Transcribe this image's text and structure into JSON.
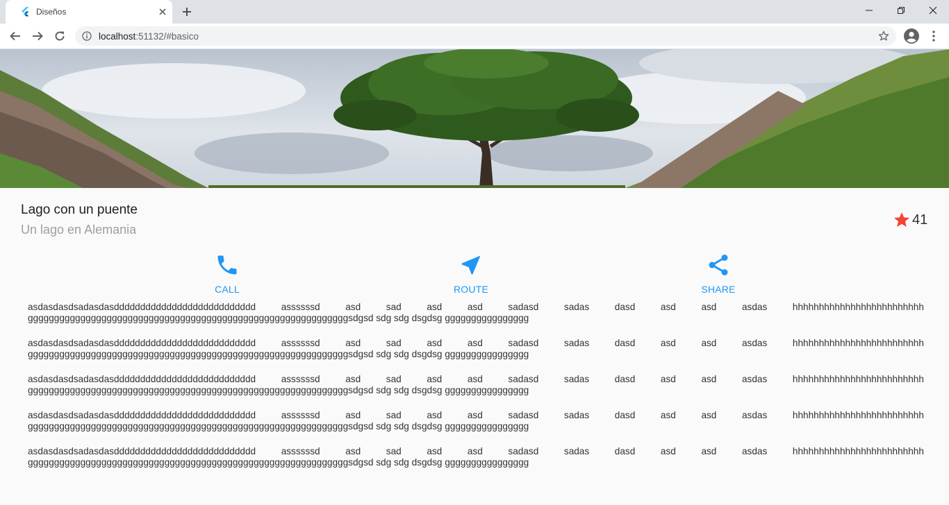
{
  "browser": {
    "tab_title": "Diseños",
    "url_host": "localhost",
    "url_path": ":51132/#basico",
    "colors": {
      "tabbar": "#dee1e6",
      "omnibox": "#f1f3f4"
    }
  },
  "header": {
    "title": "Lago con un puente",
    "subtitle": "Un lago en Alemania",
    "rating_count": "41"
  },
  "actions": [
    {
      "label": "CALL",
      "icon": "phone-icon"
    },
    {
      "label": "ROUTE",
      "icon": "navigation-arrow-icon"
    },
    {
      "label": "SHARE",
      "icon": "share-icon"
    }
  ],
  "body_text": {
    "line1_words": [
      "asdasdasdsadasdasddddddddddddddddddddddddddd",
      "assssssd",
      "asd",
      "sad",
      "asd",
      "asd",
      "sadasd",
      "sadas",
      "dasd",
      "asd",
      "asd",
      "asdas",
      "hhhhhhhhhhhhhhhhhhhhhhhhh"
    ],
    "line2": "gggggggggggggggggggggggggggggggggggggggggggggggggggggggggggggsdgsd sdg sdg dsgdsg gggggggggggggggg",
    "repeat_count": 5
  },
  "colors": {
    "accent": "#2196f3",
    "star": "#f44336",
    "background": "#fafafa"
  }
}
